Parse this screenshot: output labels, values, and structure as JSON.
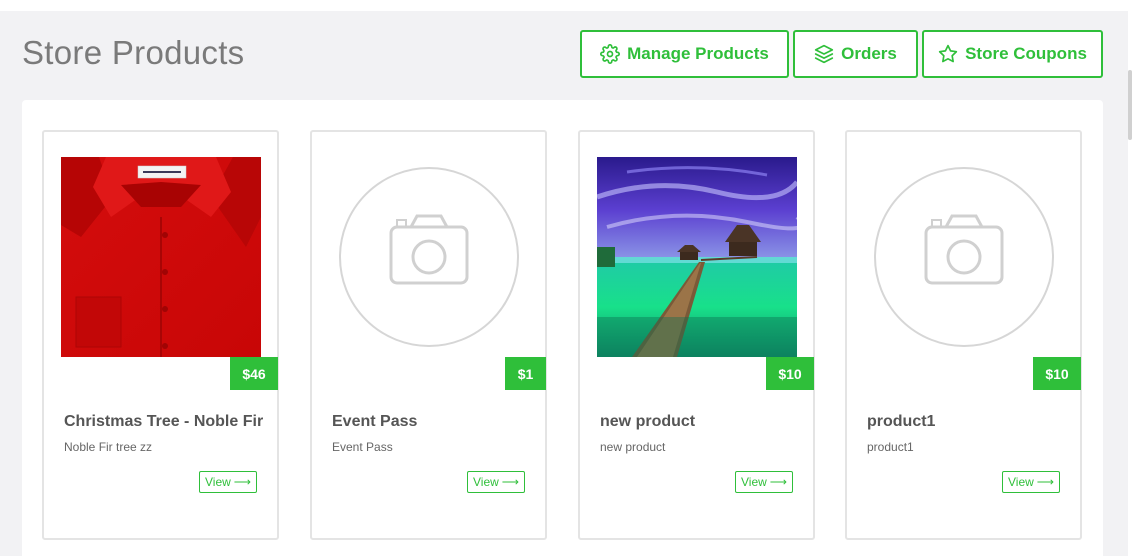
{
  "page": {
    "title": "Store Products"
  },
  "toolbar": {
    "manage_products_label": "Manage Products",
    "orders_label": "Orders",
    "store_coupons_label": "Store Coupons"
  },
  "products": [
    {
      "title": "Christmas Tree - Noble Fir",
      "description": "Noble Fir tree zz",
      "price": "$46",
      "image": "red-shirt-photo",
      "view_label": "View",
      "view_arrow": "⟶"
    },
    {
      "title": "Event Pass",
      "description": "Event Pass",
      "price": "$1",
      "image": "camera-placeholder-icon",
      "view_label": "View",
      "view_arrow": "⟶"
    },
    {
      "title": "new product",
      "description": "new product",
      "price": "$10",
      "image": "tropical-pier-photo",
      "view_label": "View",
      "view_arrow": "⟶"
    },
    {
      "title": "product1",
      "description": "product1",
      "price": "$10",
      "image": "camera-placeholder-icon",
      "view_label": "View",
      "view_arrow": "⟶"
    }
  ],
  "colors": {
    "accent": "#2fbf3a",
    "title": "#7a7a7a",
    "background": "#f2f2f4"
  }
}
